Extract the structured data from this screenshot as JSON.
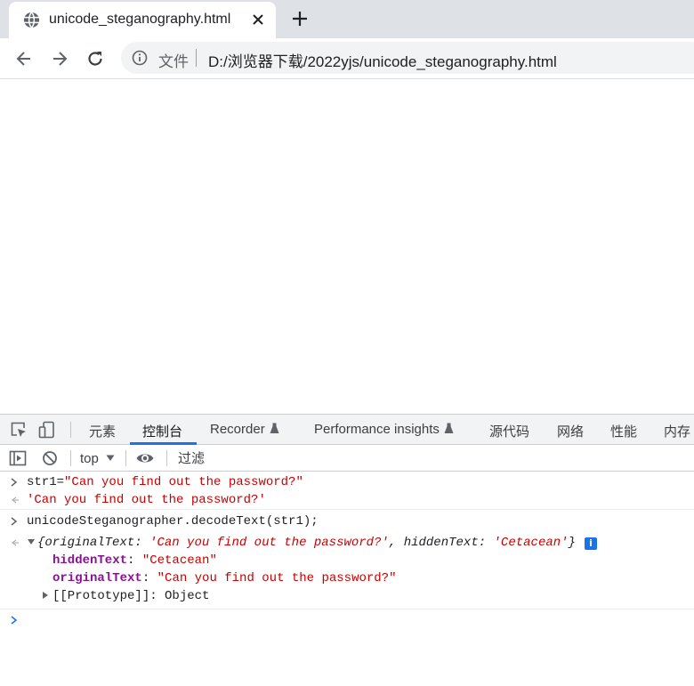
{
  "browser": {
    "tab": {
      "title": "unicode_steganography.html"
    },
    "address": {
      "label": "文件",
      "url": "D:/浏览器下载/2022yjs/unicode_steganography.html"
    }
  },
  "devtools": {
    "tabs": [
      "元素",
      "控制台",
      "Recorder",
      "Performance insights",
      "源代码",
      "网络",
      "性能",
      "内存"
    ],
    "active_tab": "控制台",
    "context": "top",
    "filter_placeholder": "过滤"
  },
  "console": {
    "cmd1": {
      "var": "str1",
      "eq": "=",
      "value": "\"Can you find out the password?\""
    },
    "res1": "'Can you find out the password?'",
    "cmd2": "unicodeSteganographer.decodeText(str1);",
    "res2": {
      "open": "{",
      "k1": "originalText",
      "v1": "'Can you find out the password?'",
      "comma": ", ",
      "k2": "hiddenText",
      "v2": "'Cetacean'",
      "close": "}",
      "badge": "i",
      "colon": ": ",
      "props": [
        {
          "key": "hiddenText",
          "value": "\"Cetacean\""
        },
        {
          "key": "originalText",
          "value": "\"Can you find out the password?\""
        }
      ],
      "proto_key": "[[Prototype]]",
      "proto_value": "Object"
    }
  }
}
